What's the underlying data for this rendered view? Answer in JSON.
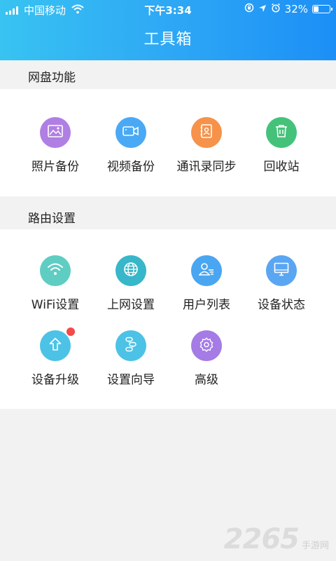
{
  "status_bar": {
    "carrier": "中国移动",
    "time": "下午3:34",
    "battery_percent": "32%",
    "battery_level": 0.32,
    "icons": [
      "signal-icon",
      "wifi-icon",
      "screen-lock-icon",
      "location-icon",
      "alarm-icon",
      "battery-icon"
    ]
  },
  "header": {
    "title": "工具箱"
  },
  "sections": {
    "cloud": {
      "title": "网盘功能",
      "items": [
        {
          "label": "照片备份",
          "icon": "image-icon",
          "color": "#b07fe3"
        },
        {
          "label": "视频备份",
          "icon": "video-camera-icon",
          "color": "#4aa9f5"
        },
        {
          "label": "通讯录同步",
          "icon": "contacts-icon",
          "color": "#f6924a"
        },
        {
          "label": "回收站",
          "icon": "trash-icon",
          "color": "#45c27a"
        }
      ]
    },
    "router": {
      "title": "路由设置",
      "items": [
        {
          "label": "WiFi设置",
          "icon": "wifi-icon",
          "color": "#5fcdc2"
        },
        {
          "label": "上网设置",
          "icon": "globe-icon",
          "color": "#37b7c9"
        },
        {
          "label": "用户列表",
          "icon": "user-list-icon",
          "color": "#4aa6f0"
        },
        {
          "label": "设备状态",
          "icon": "monitor-icon",
          "color": "#5aa6f2"
        },
        {
          "label": "设备升级",
          "icon": "upgrade-arrow-icon",
          "color": "#4cc2e6",
          "badge": true
        },
        {
          "label": "设置向导",
          "icon": "guide-icon",
          "color": "#4cc2e6"
        },
        {
          "label": "高级",
          "icon": "advanced-gear-icon",
          "color": "#a57be6"
        }
      ]
    }
  },
  "watermark": {
    "number": "2265",
    "text": "手游网"
  }
}
